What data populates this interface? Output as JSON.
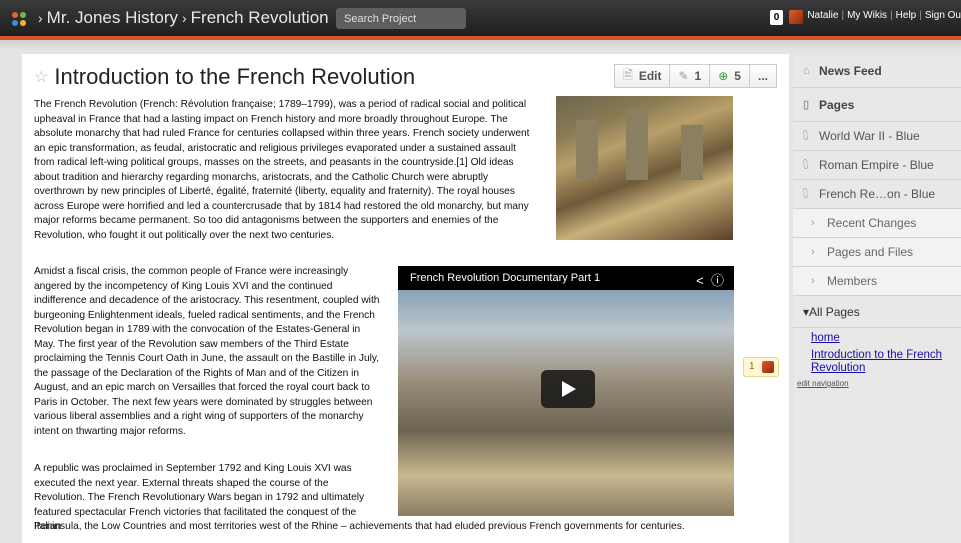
{
  "topbar": {
    "site": "Mr. Jones History",
    "page": "French Revolution",
    "search_placeholder": "Search Project",
    "notification_count": "0",
    "user": "Natalie",
    "links": [
      "My Wikis",
      "Help",
      "Sign Ou"
    ]
  },
  "page": {
    "title": "Introduction to the French Revolution",
    "edit_label": "Edit",
    "follow_count": "1",
    "history_count": "5",
    "more_label": "...",
    "p1": "The French Revolution (French: Révolution française; 1789–1799), was a period of radical social and political upheaval in France that had a lasting impact on French history and more broadly throughout Europe. The absolute monarchy that had ruled France for centuries collapsed within three years. French society underwent an epic transformation, as feudal, aristocratic and religious privileges evaporated under a sustained assault from radical left-wing political groups, masses on the streets, and peasants in the countryside.[1] Old ideas about tradition and hierarchy regarding monarchs, aristocrats, and the Catholic Church were abruptly overthrown by new principles of Liberté, égalité, fraternité (liberty, equality and fraternity). The royal houses across Europe were horrified and led a countercrusade that by 1814 had restored the old monarchy, but many major reforms became permanent. So too did antagonisms between the supporters and enemies of the Revolution, who fought it out politically over the next two centuries.",
    "p2": "Amidst a fiscal crisis, the common people of France were increasingly angered by the incompetency of King Louis XVI and the continued indifference and decadence of the aristocracy. This resentment, coupled with burgeoning Enlightenment ideals, fueled radical sentiments, and the French Revolution began in 1789 with the convocation of the Estates-General in May. The first year of the Revolution saw members of the Third Estate proclaiming the Tennis Court Oath in June, the assault on the Bastille in July, the passage of the Declaration of the Rights of Man and of the Citizen in August, and an epic march on Versailles that forced the royal court back to Paris in October. The next few years were dominated by struggles between various liberal assemblies and a right wing of supporters of the monarchy intent on thwarting major reforms.",
    "p3": "A republic was proclaimed in September 1792 and King Louis XVI was executed the next year. External threats shaped the course of the Revolution. The French Revolutionary Wars began in 1792 and ultimately featured spectacular French victories that facilitated the conquest of the Italian",
    "p3b": "Peninsula, the Low Countries and most territories west of the Rhine – achievements that had eluded previous French governments for centuries.",
    "video_title": "French Revolution Documentary Part 1",
    "comment_count": "1"
  },
  "sidebar": {
    "news_feed": "News Feed",
    "pages": "Pages",
    "recent_pages": [
      "World War II - Blue",
      "Roman Empire - Blue",
      "French Re…on - Blue"
    ],
    "sections": [
      "Recent Changes",
      "Pages and Files",
      "Members"
    ],
    "all_pages": "All Pages",
    "all_pages_links": [
      "home",
      "Introduction to the French Revolution"
    ],
    "edit_navigation": "edit navigation"
  },
  "colors": {
    "accent": "#d9532c",
    "link": "#1a0dab",
    "topbar": "#2a2a2a"
  }
}
